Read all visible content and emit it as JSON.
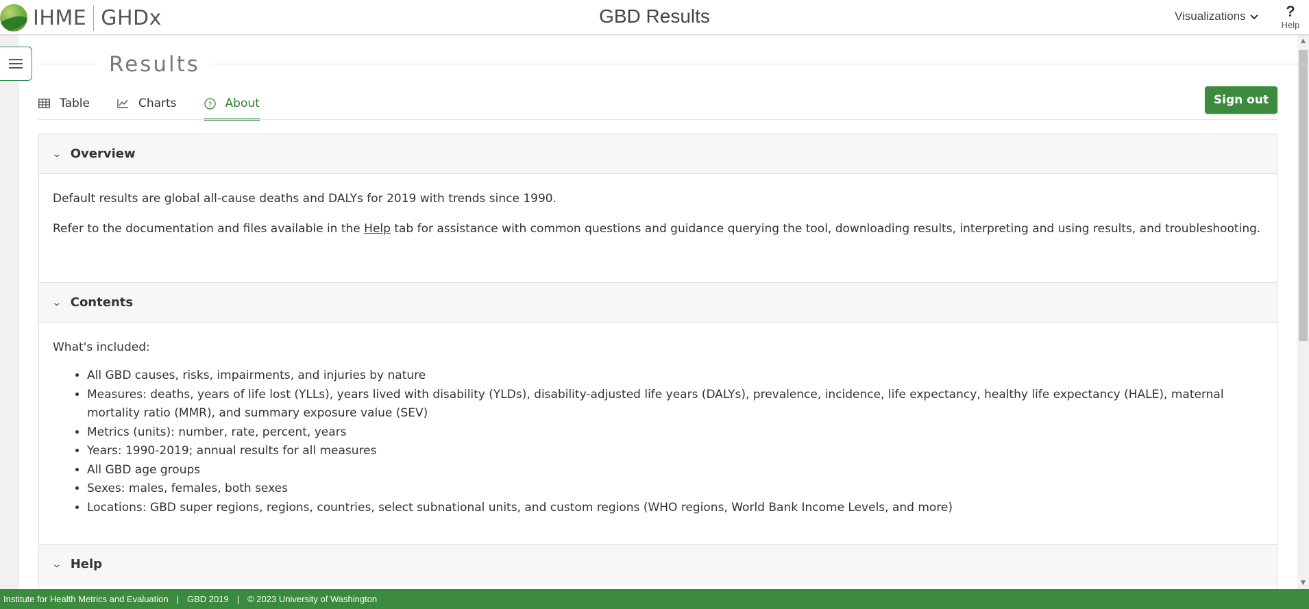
{
  "header": {
    "logo_text": "IHME",
    "logo_sub": "GHDx",
    "app_title": "GBD Results",
    "visualizations_label": "Visualizations",
    "help_label": "Help",
    "help_glyph": "?"
  },
  "page": {
    "title": "Results"
  },
  "tabs": [
    {
      "label": "Table",
      "icon": "table-icon",
      "active": false
    },
    {
      "label": "Charts",
      "icon": "line-chart-icon",
      "active": false
    },
    {
      "label": "About",
      "icon": "question-circle-icon",
      "active": true
    }
  ],
  "sign_out_label": "Sign out",
  "sections": {
    "overview": {
      "title": "Overview",
      "para1": "Default results are global all-cause deaths and DALYs for 2019 with trends since 1990.",
      "para2_before": "Refer to the documentation and files available in the ",
      "para2_link": "Help",
      "para2_after": " tab for assistance with common questions and guidance querying the tool, downloading results, interpreting and using results, and troubleshooting."
    },
    "contents": {
      "title": "Contents",
      "intro": "What's included:",
      "items": [
        "All GBD causes, risks, impairments, and injuries by nature",
        "Measures: deaths, years of life lost (YLLs), years lived with disability (YLDs), disability-adjusted life years (DALYs), prevalence, incidence, life expectancy, healthy life expectancy (HALE), maternal mortality ratio (MMR), and summary exposure value (SEV)",
        "Metrics (units): number, rate, percent, years",
        "Years: 1990-2019; annual results for all measures",
        "All GBD age groups",
        "Sexes: males, females, both sexes",
        "Locations: GBD super regions, regions, countries, select subnational units, and custom regions (WHO regions, World Bank Income Levels, and more)"
      ]
    },
    "help": {
      "title": "Help"
    }
  },
  "footer": {
    "org": "Institute for Health Metrics and Evaluation",
    "sep": "|",
    "release": "GBD 2019",
    "copyright": "© 2023 University of Washington"
  },
  "colors": {
    "accent_green": "#3b8a3e",
    "active_tab_green": "#2e7d32"
  }
}
